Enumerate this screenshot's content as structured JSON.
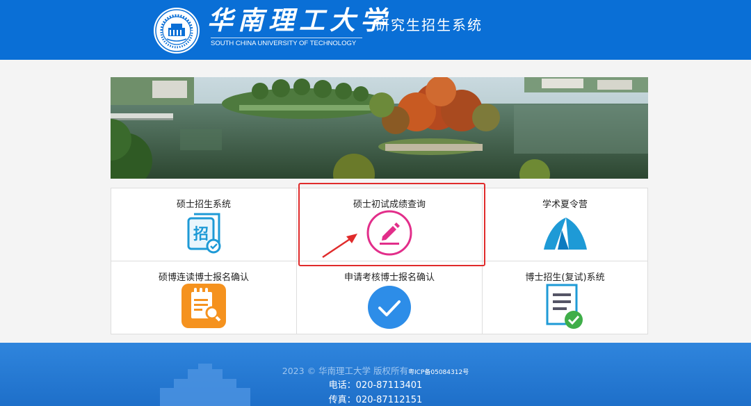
{
  "header": {
    "university_cn": "华南理工大学",
    "university_en": "SOUTH CHINA UNIVERSITY OF TECHNOLOGY",
    "system_title": "研究生招生系统",
    "brand_color": "#0a6fd6"
  },
  "menu": {
    "items": [
      {
        "label": "硕士招生系统",
        "icon": "recruit-icon"
      },
      {
        "label": "硕士初试成绩查询",
        "icon": "pencil-circle-icon"
      },
      {
        "label": "学术夏令营",
        "icon": "tent-icon"
      },
      {
        "label": "硕博连读博士报名确认",
        "icon": "document-search-icon"
      },
      {
        "label": "申请考核博士报名确认",
        "icon": "checkmark-circle-icon"
      },
      {
        "label": "博士招生(复试)系统",
        "icon": "document-check-icon"
      }
    ],
    "highlight_color": "#e02b2b"
  },
  "footer": {
    "copyright": "2023 © 华南理工大学 版权所有",
    "icp": "粤ICP备05084312号",
    "phone": "电话：020-87113401",
    "fax": "传真：020-87112151"
  }
}
